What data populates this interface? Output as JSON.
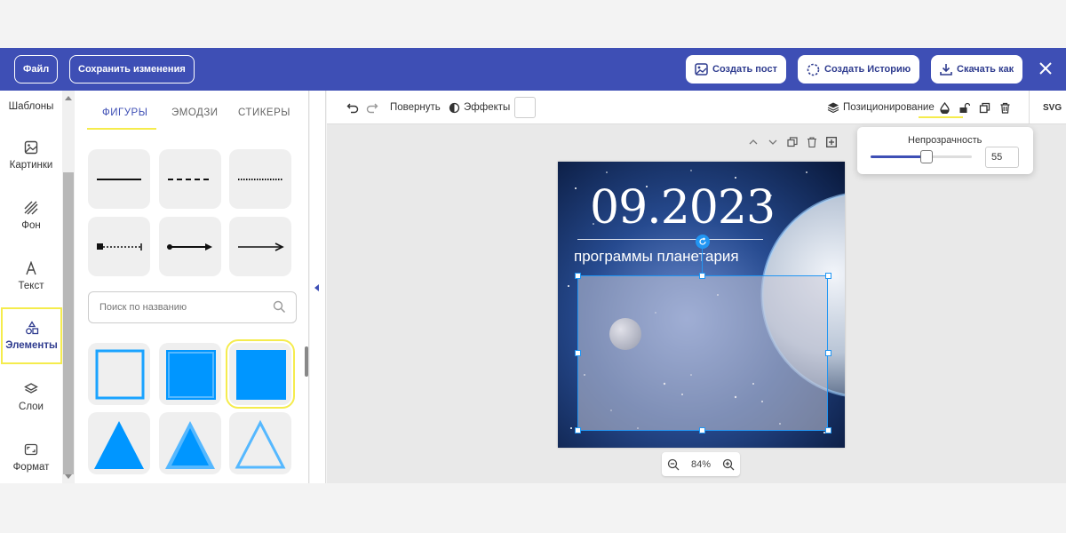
{
  "header": {
    "file_label": "Файл",
    "save_label": "Сохранить изменения",
    "create_post_label": "Создать пост",
    "create_story_label": "Создать Историю",
    "download_label": "Скачать как"
  },
  "sidebar": {
    "items": [
      {
        "label": "Шаблоны",
        "icon": "templates-icon"
      },
      {
        "label": "Картинки",
        "icon": "image-icon"
      },
      {
        "label": "Фон",
        "icon": "background-icon"
      },
      {
        "label": "Текст",
        "icon": "text-icon"
      },
      {
        "label": "Элементы",
        "icon": "shapes-icon",
        "active": true
      },
      {
        "label": "Слои",
        "icon": "layers-icon"
      },
      {
        "label": "Формат",
        "icon": "format-icon"
      }
    ]
  },
  "panel": {
    "tabs": [
      {
        "label": "ФИГУРЫ",
        "active": true
      },
      {
        "label": "ЭМОДЗИ"
      },
      {
        "label": "СТИКЕРЫ"
      }
    ],
    "search_placeholder": "Поиск по названию"
  },
  "toolbar": {
    "rotate_label": "Повернуть",
    "effects_label": "Эффекты",
    "positioning_label": "Позиционирование",
    "svg_label": "SVG"
  },
  "artboard": {
    "date_text": "09.2023",
    "subtitle_text": "программы планетария"
  },
  "zoom": {
    "value": "84%"
  },
  "opacity_popover": {
    "title": "Непрозрачность",
    "value": "55",
    "level_percent": 55
  },
  "colors": {
    "accent": "#3e4fb5",
    "highlight": "#f5ec4d",
    "shape_fill": "#0096ff",
    "selection": "#2196f3"
  }
}
